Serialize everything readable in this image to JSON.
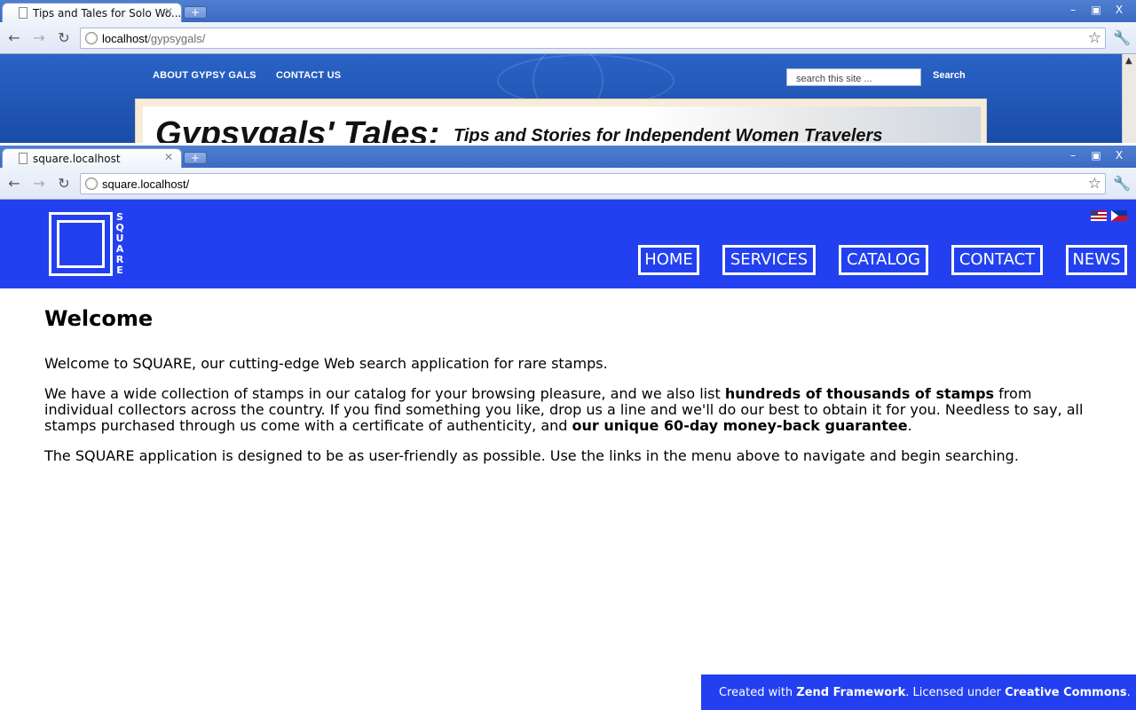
{
  "back_window": {
    "tab_title": "Tips and Tales for Solo Wo...",
    "url_host": "localhost",
    "url_path": "/gypsygals/",
    "nav": [
      "ABOUT GYPSY GALS",
      "CONTACT US"
    ],
    "search_placeholder": "search this site ...",
    "search_button": "Search",
    "banner_title": "Gypsygals' Tales:",
    "banner_subtitle": "Tips and Stories for Independent Women Travelers"
  },
  "front_window": {
    "tab_title": "square.localhost",
    "url": "square.localhost/"
  },
  "window_controls": [
    "–",
    "▣",
    "X"
  ],
  "site": {
    "logo_text": "SQUARE",
    "logo_letters": [
      "S",
      "Q",
      "U",
      "A",
      "R",
      "E"
    ],
    "nav": [
      "HOME",
      "SERVICES",
      "CATALOG",
      "CONTACT",
      "NEWS"
    ],
    "flags": [
      "us-flag-icon",
      "ph-flag-icon"
    ],
    "heading": "Welcome",
    "para1": "Welcome to SQUARE, our cutting-edge Web search application for rare stamps.",
    "para2_a": "We have a wide collection of stamps in our catalog for your browsing pleasure, and we also list ",
    "para2_b": "hundreds of thousands of stamps",
    "para2_c": " from individual collectors across the country. If you find something you like, drop us a line and we'll do our best to obtain it for you. Needless to say, all stamps purchased through us come with a certificate of authenticity, and ",
    "para2_d": "our unique 60-day money-back guarantee",
    "para2_e": ".",
    "para3": "The SQUARE application is designed to be as user-friendly as possible. Use the links in the menu above to navigate and begin searching.",
    "footer_a": "Created with ",
    "footer_b": "Zend Framework",
    "footer_c": ". Licensed under ",
    "footer_d": "Creative Commons",
    "footer_e": "."
  }
}
